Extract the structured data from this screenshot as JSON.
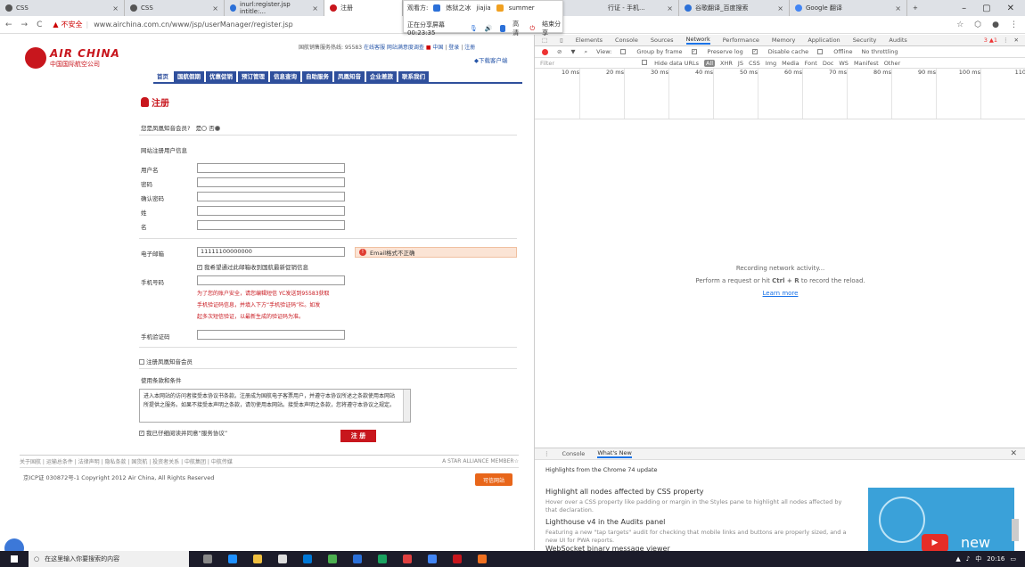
{
  "browser": {
    "tabs": [
      {
        "label": "CSS"
      },
      {
        "label": "CSS"
      },
      {
        "label": "inurl:register.jsp intitle:..."
      },
      {
        "label": "注册"
      },
      {
        "label": "行证 - 手机..."
      },
      {
        "label": "谷歌翻译_百度搜索"
      },
      {
        "label": "Google 翻译"
      }
    ],
    "new_tab": "+",
    "window_controls": [
      "–",
      "▢",
      "✕"
    ],
    "share_bar": {
      "viewer_label": "观看方:",
      "viewers": [
        "炼狱之冰",
        "jiajia",
        "summer"
      ],
      "sharing_text": "正在分享屏幕 00:23:35",
      "hd_label": "高清",
      "end_label": "结束分享"
    },
    "address": {
      "not_secure": "不安全",
      "url": "www.airchina.com.cn/www/jsp/userManager/register.jsp"
    }
  },
  "site": {
    "logo_en": "AIR CHINA",
    "logo_cn": "中国国际航空公司",
    "top_links": {
      "hotline": "国航销售服务热线: 95583",
      "online_service": "在线客服",
      "survey": "网站满意度调查",
      "region": "中国",
      "login": "登录",
      "register": "注册"
    },
    "download": "下载客户端",
    "nav": [
      "首页",
      "国航假期",
      "优惠促销",
      "预订管理",
      "信息查询",
      "自助服务",
      "凤凰知音",
      "企业差旅",
      "联系我们"
    ],
    "page_title": "注册"
  },
  "form": {
    "member_question": "您是凤凰知音会员?",
    "member_yes": "是",
    "member_no": "否",
    "section_title": "网站注册用户信息",
    "labels": {
      "username": "用户名",
      "password": "密码",
      "confirm_password": "确认密码",
      "surname": "姓",
      "given_name": "名",
      "email": "电子邮箱",
      "mobile": "手机号码",
      "code": "手机验证码"
    },
    "values": {
      "username": "",
      "password": "",
      "confirm_password": "",
      "surname": "",
      "given_name": "",
      "email": "11111100000000",
      "mobile": "",
      "code": ""
    },
    "email_error": "Email格式不正确",
    "email_opt_in": "我希望通过此邮箱收到国航最新促销信息",
    "mobile_notice": [
      "为了您的账户安全，请您编辑短信 YC发送到95583获取",
      "手机验证码信息，并填入下方“手机验证码”栏。如发",
      "起多次短信验证，以最新生成的验证码为准。"
    ],
    "register_member": "注册凤凰知音会员",
    "terms_title": "使用条款和条件",
    "terms_text": "进入本网站的访问者接受本协议书条款。注册成为国航电子客票用户，并遵守本协议所述之条款使用本网站所提供之服务。如果不接受本声明之条款，请勿使用本网站。接受本声明之条款，您将遵守本协议之规定。",
    "agree": "我已仔细阅读并同意“服务协议”",
    "submit": "注 册"
  },
  "footer": {
    "links": "关于国航 | 运输总条件 | 法律声明 | 隐私条款 | 国货航 | 投资者关系 | 中航集团 | 中航传媒",
    "star_alliance": "A STAR ALLIANCE MEMBER",
    "copyright": "京ICP证 030872号-1 Copyright 2012 Air China, All Rights Reserved",
    "credit_badge": "可信网站"
  },
  "devtools": {
    "tabs": [
      "Elements",
      "Console",
      "Sources",
      "Network",
      "Performance",
      "Memory",
      "Application",
      "Security",
      "Audits"
    ],
    "status": "3 ▲1",
    "network_toolbar": {
      "view": "View:",
      "group_by_frame": "Group by frame",
      "preserve_log": "Preserve log",
      "disable_cache": "Disable cache",
      "offline": "Offline",
      "throttle": "No throttling"
    },
    "filter_placeholder": "Filter",
    "hide_data_urls": "Hide data URLs",
    "types": [
      "All",
      "XHR",
      "JS",
      "CSS",
      "Img",
      "Media",
      "Font",
      "Doc",
      "WS",
      "Manifest",
      "Other"
    ],
    "timeline": [
      "10 ms",
      "20 ms",
      "30 ms",
      "40 ms",
      "50 ms",
      "60 ms",
      "70 ms",
      "80 ms",
      "90 ms",
      "100 ms",
      "110"
    ],
    "recording": "Recording network activity...",
    "hint_pre": "Perform a request or hit",
    "hint_key": "Ctrl + R",
    "hint_post": "to record the reload.",
    "learn_more": "Learn more",
    "drawer_tabs": [
      "Console",
      "What's New"
    ],
    "whats_new_header": "Highlights from the Chrome 74 update",
    "items": [
      {
        "title": "Highlight all nodes affected by CSS property",
        "desc": "Hover over a CSS property like padding or margin in the Styles pane to highlight all nodes affected by that declaration."
      },
      {
        "title": "Lighthouse v4 in the Audits panel",
        "desc": "Featuring a new \"tap targets\" audit for checking that mobile links and buttons are properly sized, and a new UI for PWA reports."
      },
      {
        "title": "WebSocket binary message viewer",
        "desc": ""
      }
    ],
    "thumb_label": "new"
  },
  "taskbar": {
    "search_placeholder": "在这里输入你要搜索的内容",
    "time": "20:16",
    "ime": "中"
  }
}
